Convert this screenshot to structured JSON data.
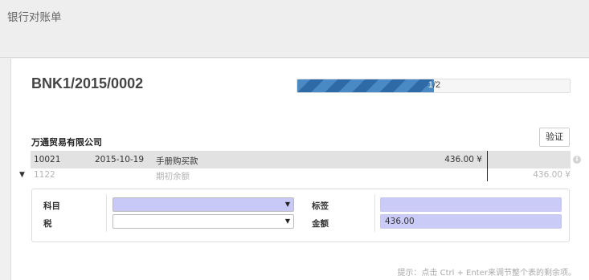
{
  "header": {
    "title": "银行对账单"
  },
  "statement": {
    "reference": "BNK1/2015/0002"
  },
  "progress": {
    "current": "1",
    "separator": "/",
    "total": "2",
    "fraction": 0.5
  },
  "partner": {
    "name": "万通贸易有限公司"
  },
  "buttons": {
    "verify": "验证"
  },
  "statement_line": {
    "account": "10021",
    "date": "2015-10-19",
    "label": "手册购买款",
    "amount": "436.00 ¥"
  },
  "proposition_line": {
    "account": "1122",
    "label": "期初余额",
    "amount": "436.00 ¥"
  },
  "form": {
    "account_label": "科目",
    "tax_label": "税",
    "tag_label": "标签",
    "amount_label": "金额",
    "amount_value": "436.00"
  },
  "hint": "提示：点击 Ctrl + Enter来调节整个表的剩余项。",
  "colors": {
    "progress_fill": "#3b7ab8",
    "required_field": "#cbcbf8"
  },
  "icons": {
    "expand": "caret-down-icon",
    "info": "info-icon",
    "dropdown": "dropdown-arrow-icon"
  }
}
